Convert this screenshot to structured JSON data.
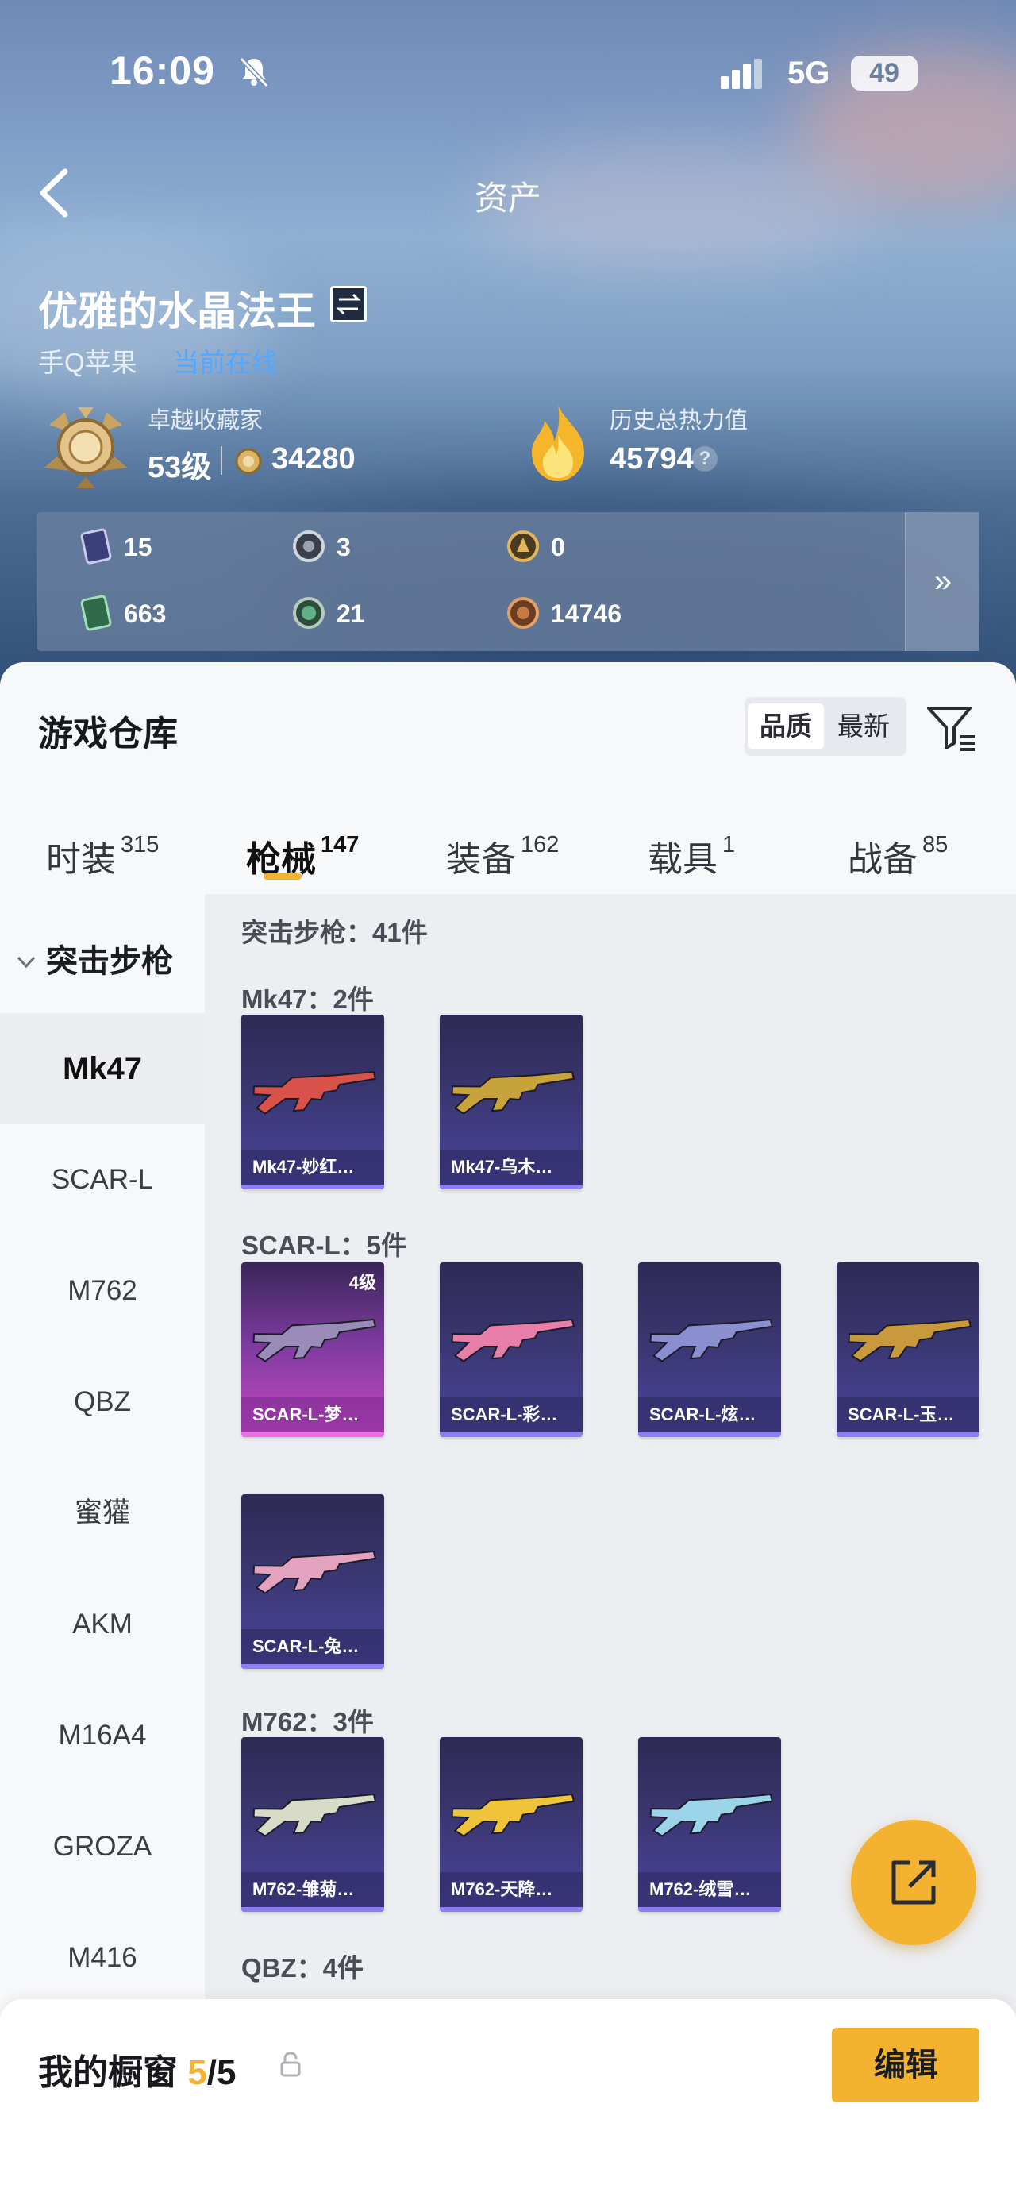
{
  "status_bar": {
    "time": "16:09",
    "network": "5G",
    "battery": "49"
  },
  "nav": {
    "title": "资产"
  },
  "profile": {
    "name": "优雅的水晶法王",
    "platform": "手Q苹果",
    "online_status": "当前在线",
    "collector_title": "卓越收藏家",
    "level": "53级",
    "collector_points": "34280",
    "heat_label": "历史总热力值",
    "heat_value": "45794",
    "help_mark": "?"
  },
  "resources": [
    {
      "icon": "card-icon",
      "value": "15"
    },
    {
      "icon": "silver-token-icon",
      "value": "3"
    },
    {
      "icon": "gold-token-icon",
      "value": "0"
    },
    {
      "icon": "green-card-icon",
      "value": "663"
    },
    {
      "icon": "green-orb-icon",
      "value": "21"
    },
    {
      "icon": "bronze-coin-icon",
      "value": "14746"
    }
  ],
  "resources_more": "»",
  "warehouse": {
    "title": "游戏仓库",
    "sort_options": [
      "品质",
      "最新"
    ],
    "sort_active": 0,
    "tabs": [
      {
        "label": "时装",
        "count": "315"
      },
      {
        "label": "枪械",
        "count": "147"
      },
      {
        "label": "装备",
        "count": "162"
      },
      {
        "label": "载具",
        "count": "1"
      },
      {
        "label": "战备",
        "count": "85"
      }
    ],
    "active_tab": 1
  },
  "sidebar": {
    "group": "突击步枪",
    "items": [
      "Mk47",
      "SCAR-L",
      "M762",
      "QBZ",
      "蜜獾",
      "AKM",
      "M16A4",
      "GROZA",
      "M416"
    ],
    "active": 0
  },
  "content": {
    "category_summary": "突击步枪：41件",
    "sections": [
      {
        "heading": "Mk47：2件",
        "items": [
          {
            "name": "Mk47-妙红…",
            "color": "#d9524a"
          },
          {
            "name": "Mk47-乌木…",
            "color": "#c8a23a"
          }
        ]
      },
      {
        "heading": "SCAR-L：5件",
        "items": [
          {
            "name": "SCAR-L-梦…",
            "color": "#9a8cb8",
            "level": "4级",
            "rarity": "epic"
          },
          {
            "name": "SCAR-L-彩…",
            "color": "#e77fa8"
          },
          {
            "name": "SCAR-L-炫…",
            "color": "#8a8fd0"
          },
          {
            "name": "SCAR-L-玉…",
            "color": "#c9993e"
          },
          {
            "name": "SCAR-L-兔…",
            "color": "#e3a2bf"
          }
        ]
      },
      {
        "heading": "M762：3件",
        "items": [
          {
            "name": "M762-雏菊…",
            "color": "#d8dbc8"
          },
          {
            "name": "M762-天降…",
            "color": "#f0c43a"
          },
          {
            "name": "M762-绒雪…",
            "color": "#9cd4ea"
          }
        ]
      },
      {
        "heading": "QBZ：4件",
        "items": []
      }
    ]
  },
  "showcase": {
    "title": "我的橱窗",
    "count": "5",
    "total": "/5",
    "edit_label": "编辑"
  },
  "colors": {
    "accent": "#f3b22f",
    "online": "#52a8ff"
  }
}
